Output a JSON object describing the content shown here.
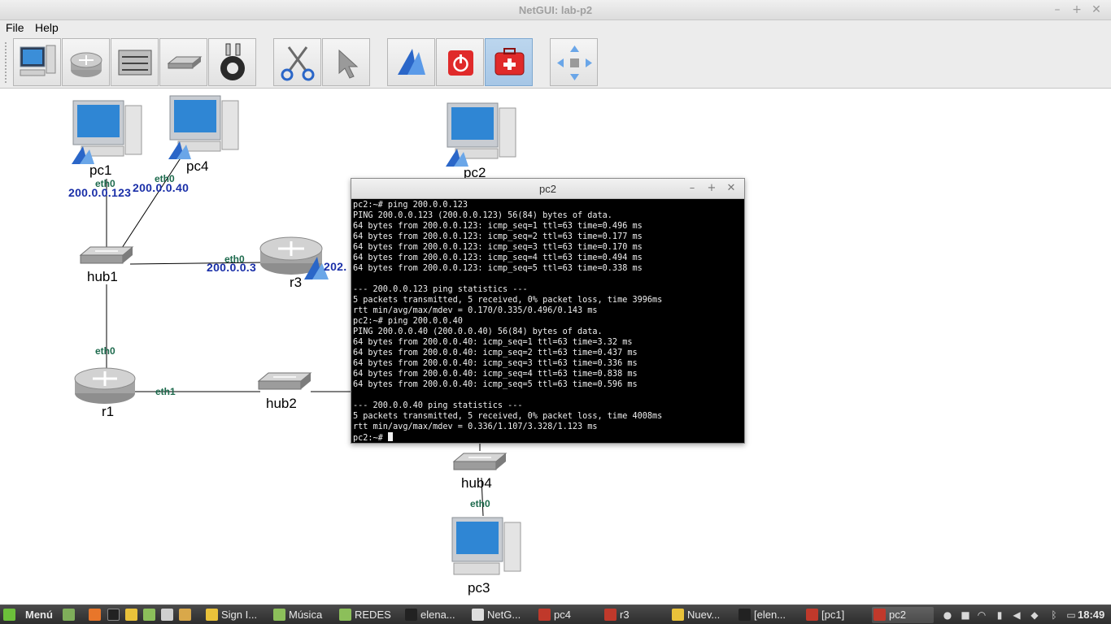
{
  "window": {
    "title": "NetGUI: lab-p2"
  },
  "menu": {
    "file": "File",
    "help": "Help"
  },
  "toolbar": {
    "buttons": [
      "terminal-pc",
      "router",
      "switch",
      "hub",
      "cable",
      "cut",
      "select",
      "start",
      "stop",
      "help-kit",
      "move"
    ],
    "colors": {
      "active": "#a6c6e6",
      "stop_red": "#e02a2a"
    }
  },
  "network": {
    "nodes": {
      "pc1": "pc1",
      "pc4": "pc4",
      "pc2": "pc2",
      "pc3": "pc3",
      "hub1": "hub1",
      "hub2": "hub2",
      "hub4": "hub4",
      "r1": "r1",
      "r3": "r3"
    },
    "interfaces": {
      "pc1_eth0": "eth0",
      "pc4_eth0": "eth0",
      "r3_eth0": "eth0",
      "r1_eth0": "eth0",
      "r1_eth1": "eth1",
      "pc3_eth0": "eth0"
    },
    "ips": {
      "pc1": "200.0.0.123",
      "pc4": "200.0.0.40",
      "r3": "200.0.0.3",
      "r3_partial": "202."
    },
    "colors": {
      "interface": "#1d6a4d",
      "ip": "#1a2fa8"
    }
  },
  "terminal": {
    "title": "pc2",
    "lines": [
      "pc2:~# ping 200.0.0.123",
      "PING 200.0.0.123 (200.0.0.123) 56(84) bytes of data.",
      "64 bytes from 200.0.0.123: icmp_seq=1 ttl=63 time=0.496 ms",
      "64 bytes from 200.0.0.123: icmp_seq=2 ttl=63 time=0.177 ms",
      "64 bytes from 200.0.0.123: icmp_seq=3 ttl=63 time=0.170 ms",
      "64 bytes from 200.0.0.123: icmp_seq=4 ttl=63 time=0.494 ms",
      "64 bytes from 200.0.0.123: icmp_seq=5 ttl=63 time=0.338 ms",
      "",
      "--- 200.0.0.123 ping statistics ---",
      "5 packets transmitted, 5 received, 0% packet loss, time 3996ms",
      "rtt min/avg/max/mdev = 0.170/0.335/0.496/0.143 ms",
      "pc2:~# ping 200.0.0.40",
      "PING 200.0.0.40 (200.0.0.40) 56(84) bytes of data.",
      "64 bytes from 200.0.0.40: icmp_seq=1 ttl=63 time=3.32 ms",
      "64 bytes from 200.0.0.40: icmp_seq=2 ttl=63 time=0.437 ms",
      "64 bytes from 200.0.0.40: icmp_seq=3 ttl=63 time=0.336 ms",
      "64 bytes from 200.0.0.40: icmp_seq=4 ttl=63 time=0.838 ms",
      "64 bytes from 200.0.0.40: icmp_seq=5 ttl=63 time=0.596 ms",
      "",
      "--- 200.0.0.40 ping statistics ---",
      "5 packets transmitted, 5 received, 0% packet loss, time 4008ms",
      "rtt min/avg/max/mdev = 0.336/1.107/3.328/1.123 ms"
    ],
    "prompt": "pc2:~# "
  },
  "taskbar": {
    "menu_label": "Menú",
    "items": [
      "Sign I...",
      "Música",
      "REDES",
      "elena...",
      "NetG...",
      "pc4",
      "r3",
      "Nuev...",
      "[elen...",
      "[pc1]",
      "pc2"
    ],
    "clock": "18:49"
  }
}
